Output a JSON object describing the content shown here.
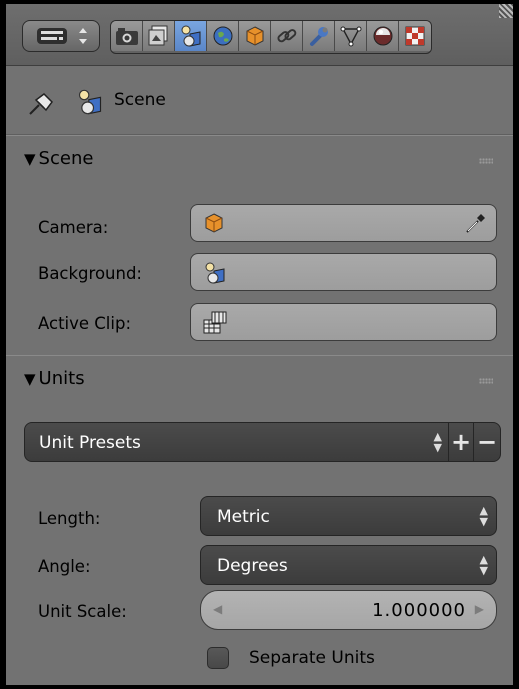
{
  "header": {
    "editor_type_icon": "properties-editor-icon",
    "tabs": [
      {
        "name": "render-tab",
        "icon": "camera-render-icon"
      },
      {
        "name": "render-layers-tab",
        "icon": "render-layers-icon"
      },
      {
        "name": "scene-tab",
        "icon": "scene-icon",
        "active": true
      },
      {
        "name": "world-tab",
        "icon": "world-icon"
      },
      {
        "name": "object-tab",
        "icon": "object-cube-icon"
      },
      {
        "name": "constraints-tab",
        "icon": "constraint-link-icon"
      },
      {
        "name": "modifiers-tab",
        "icon": "wrench-icon"
      },
      {
        "name": "data-tab",
        "icon": "mesh-data-icon"
      },
      {
        "name": "material-tab",
        "icon": "material-sphere-icon"
      },
      {
        "name": "texture-tab",
        "icon": "texture-checker-icon"
      }
    ]
  },
  "context": {
    "label": "Scene"
  },
  "scene_panel": {
    "title": "Scene",
    "camera_label": "Camera:",
    "background_label": "Background:",
    "active_clip_label": "Active Clip:"
  },
  "units_panel": {
    "title": "Units",
    "presets_label": "Unit Presets",
    "length_label": "Length:",
    "length_value": "Metric",
    "angle_label": "Angle:",
    "angle_value": "Degrees",
    "unit_scale_label": "Unit Scale:",
    "unit_scale_value": "1.000000",
    "separate_units_label": "Separate Units",
    "separate_units_checked": false
  },
  "colors": {
    "panel_bg": "#727272",
    "active_tab": "#5a86c8",
    "dark_widget": "#414141",
    "object_orange": "#e7912b"
  }
}
